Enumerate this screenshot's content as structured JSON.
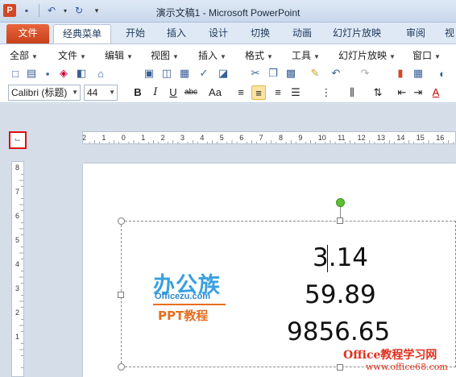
{
  "window": {
    "title": "演示文稿1 - Microsoft PowerPoint",
    "app_icon": "P"
  },
  "qat": {
    "icons": [
      "save-icon",
      "undo-icon",
      "redo-icon",
      "customize-icon"
    ]
  },
  "tabs": [
    "文件",
    "经典菜单",
    "开始",
    "插入",
    "设计",
    "切换",
    "动画",
    "幻灯片放映",
    "审阅",
    "视"
  ],
  "menus": [
    "全部",
    "文件",
    "编辑",
    "视图",
    "插入",
    "格式",
    "工具",
    "幻灯片放映",
    "窗口"
  ],
  "font": {
    "name": "Calibri (标题)",
    "size": "44"
  },
  "format_buttons": {
    "bold": "B",
    "italic": "I",
    "underline": "U",
    "strike": "abc",
    "case": "Aa"
  },
  "ruler": {
    "h_labels": [
      "2",
      "1",
      "0",
      "1",
      "2",
      "3",
      "4",
      "5",
      "6",
      "7",
      "8",
      "9",
      "10",
      "11",
      "12",
      "13",
      "14",
      "15",
      "16"
    ],
    "v_labels": [
      "8",
      "7",
      "6",
      "5",
      "4",
      "3",
      "2",
      "1"
    ]
  },
  "slide": {
    "numbers": [
      "3.14",
      "59.89",
      "9856.65"
    ],
    "logo": {
      "main": "办公族",
      "url": "Officezu.com",
      "sub": "PPT教程"
    }
  },
  "watermark": {
    "line1": "Office教程学习网",
    "line2": "www.office68.com"
  },
  "colors": {
    "file_tab": "#d24726",
    "rotate_handle": "#5bc133",
    "highlight": "#fbe3a3",
    "watermark": "#e0301e"
  }
}
